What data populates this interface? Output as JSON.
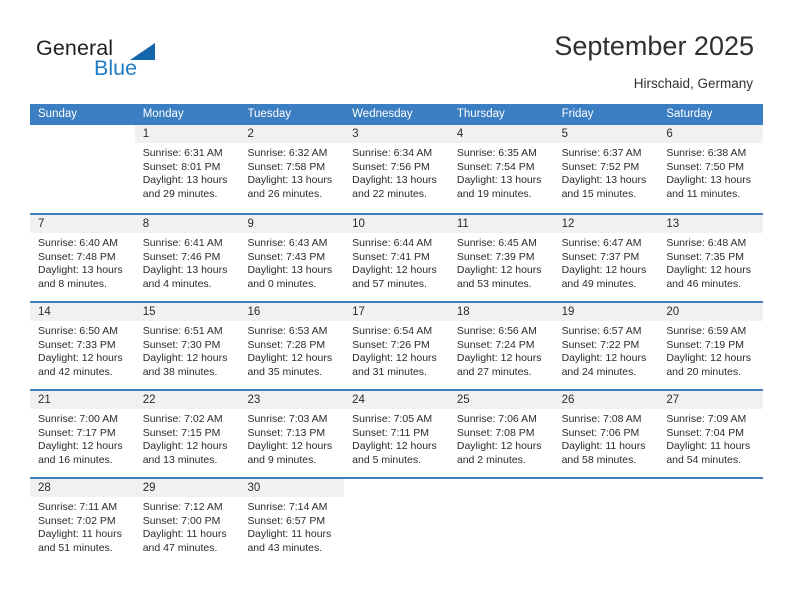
{
  "brand": {
    "name_part1": "General",
    "name_part2": "Blue",
    "triangle_color": "#1565ad",
    "blue_color": "#1f7dc7"
  },
  "header": {
    "title": "September 2025",
    "location": "Hirschaid, Germany"
  },
  "theme": {
    "header_bg": "#3b7ec1",
    "daynum_bg": "#f1f1f1",
    "text": "#2b2b2b"
  },
  "weekdays": [
    "Sunday",
    "Monday",
    "Tuesday",
    "Wednesday",
    "Thursday",
    "Friday",
    "Saturday"
  ],
  "weeks": [
    [
      {
        "day": "",
        "sunrise": "",
        "sunset": "",
        "daylight": ""
      },
      {
        "day": "1",
        "sunrise": "Sunrise: 6:31 AM",
        "sunset": "Sunset: 8:01 PM",
        "daylight": "Daylight: 13 hours and 29 minutes."
      },
      {
        "day": "2",
        "sunrise": "Sunrise: 6:32 AM",
        "sunset": "Sunset: 7:58 PM",
        "daylight": "Daylight: 13 hours and 26 minutes."
      },
      {
        "day": "3",
        "sunrise": "Sunrise: 6:34 AM",
        "sunset": "Sunset: 7:56 PM",
        "daylight": "Daylight: 13 hours and 22 minutes."
      },
      {
        "day": "4",
        "sunrise": "Sunrise: 6:35 AM",
        "sunset": "Sunset: 7:54 PM",
        "daylight": "Daylight: 13 hours and 19 minutes."
      },
      {
        "day": "5",
        "sunrise": "Sunrise: 6:37 AM",
        "sunset": "Sunset: 7:52 PM",
        "daylight": "Daylight: 13 hours and 15 minutes."
      },
      {
        "day": "6",
        "sunrise": "Sunrise: 6:38 AM",
        "sunset": "Sunset: 7:50 PM",
        "daylight": "Daylight: 13 hours and 11 minutes."
      }
    ],
    [
      {
        "day": "7",
        "sunrise": "Sunrise: 6:40 AM",
        "sunset": "Sunset: 7:48 PM",
        "daylight": "Daylight: 13 hours and 8 minutes."
      },
      {
        "day": "8",
        "sunrise": "Sunrise: 6:41 AM",
        "sunset": "Sunset: 7:46 PM",
        "daylight": "Daylight: 13 hours and 4 minutes."
      },
      {
        "day": "9",
        "sunrise": "Sunrise: 6:43 AM",
        "sunset": "Sunset: 7:43 PM",
        "daylight": "Daylight: 13 hours and 0 minutes."
      },
      {
        "day": "10",
        "sunrise": "Sunrise: 6:44 AM",
        "sunset": "Sunset: 7:41 PM",
        "daylight": "Daylight: 12 hours and 57 minutes."
      },
      {
        "day": "11",
        "sunrise": "Sunrise: 6:45 AM",
        "sunset": "Sunset: 7:39 PM",
        "daylight": "Daylight: 12 hours and 53 minutes."
      },
      {
        "day": "12",
        "sunrise": "Sunrise: 6:47 AM",
        "sunset": "Sunset: 7:37 PM",
        "daylight": "Daylight: 12 hours and 49 minutes."
      },
      {
        "day": "13",
        "sunrise": "Sunrise: 6:48 AM",
        "sunset": "Sunset: 7:35 PM",
        "daylight": "Daylight: 12 hours and 46 minutes."
      }
    ],
    [
      {
        "day": "14",
        "sunrise": "Sunrise: 6:50 AM",
        "sunset": "Sunset: 7:33 PM",
        "daylight": "Daylight: 12 hours and 42 minutes."
      },
      {
        "day": "15",
        "sunrise": "Sunrise: 6:51 AM",
        "sunset": "Sunset: 7:30 PM",
        "daylight": "Daylight: 12 hours and 38 minutes."
      },
      {
        "day": "16",
        "sunrise": "Sunrise: 6:53 AM",
        "sunset": "Sunset: 7:28 PM",
        "daylight": "Daylight: 12 hours and 35 minutes."
      },
      {
        "day": "17",
        "sunrise": "Sunrise: 6:54 AM",
        "sunset": "Sunset: 7:26 PM",
        "daylight": "Daylight: 12 hours and 31 minutes."
      },
      {
        "day": "18",
        "sunrise": "Sunrise: 6:56 AM",
        "sunset": "Sunset: 7:24 PM",
        "daylight": "Daylight: 12 hours and 27 minutes."
      },
      {
        "day": "19",
        "sunrise": "Sunrise: 6:57 AM",
        "sunset": "Sunset: 7:22 PM",
        "daylight": "Daylight: 12 hours and 24 minutes."
      },
      {
        "day": "20",
        "sunrise": "Sunrise: 6:59 AM",
        "sunset": "Sunset: 7:19 PM",
        "daylight": "Daylight: 12 hours and 20 minutes."
      }
    ],
    [
      {
        "day": "21",
        "sunrise": "Sunrise: 7:00 AM",
        "sunset": "Sunset: 7:17 PM",
        "daylight": "Daylight: 12 hours and 16 minutes."
      },
      {
        "day": "22",
        "sunrise": "Sunrise: 7:02 AM",
        "sunset": "Sunset: 7:15 PM",
        "daylight": "Daylight: 12 hours and 13 minutes."
      },
      {
        "day": "23",
        "sunrise": "Sunrise: 7:03 AM",
        "sunset": "Sunset: 7:13 PM",
        "daylight": "Daylight: 12 hours and 9 minutes."
      },
      {
        "day": "24",
        "sunrise": "Sunrise: 7:05 AM",
        "sunset": "Sunset: 7:11 PM",
        "daylight": "Daylight: 12 hours and 5 minutes."
      },
      {
        "day": "25",
        "sunrise": "Sunrise: 7:06 AM",
        "sunset": "Sunset: 7:08 PM",
        "daylight": "Daylight: 12 hours and 2 minutes."
      },
      {
        "day": "26",
        "sunrise": "Sunrise: 7:08 AM",
        "sunset": "Sunset: 7:06 PM",
        "daylight": "Daylight: 11 hours and 58 minutes."
      },
      {
        "day": "27",
        "sunrise": "Sunrise: 7:09 AM",
        "sunset": "Sunset: 7:04 PM",
        "daylight": "Daylight: 11 hours and 54 minutes."
      }
    ],
    [
      {
        "day": "28",
        "sunrise": "Sunrise: 7:11 AM",
        "sunset": "Sunset: 7:02 PM",
        "daylight": "Daylight: 11 hours and 51 minutes."
      },
      {
        "day": "29",
        "sunrise": "Sunrise: 7:12 AM",
        "sunset": "Sunset: 7:00 PM",
        "daylight": "Daylight: 11 hours and 47 minutes."
      },
      {
        "day": "30",
        "sunrise": "Sunrise: 7:14 AM",
        "sunset": "Sunset: 6:57 PM",
        "daylight": "Daylight: 11 hours and 43 minutes."
      },
      {
        "day": "",
        "sunrise": "",
        "sunset": "",
        "daylight": ""
      },
      {
        "day": "",
        "sunrise": "",
        "sunset": "",
        "daylight": ""
      },
      {
        "day": "",
        "sunrise": "",
        "sunset": "",
        "daylight": ""
      },
      {
        "day": "",
        "sunrise": "",
        "sunset": "",
        "daylight": ""
      }
    ]
  ]
}
